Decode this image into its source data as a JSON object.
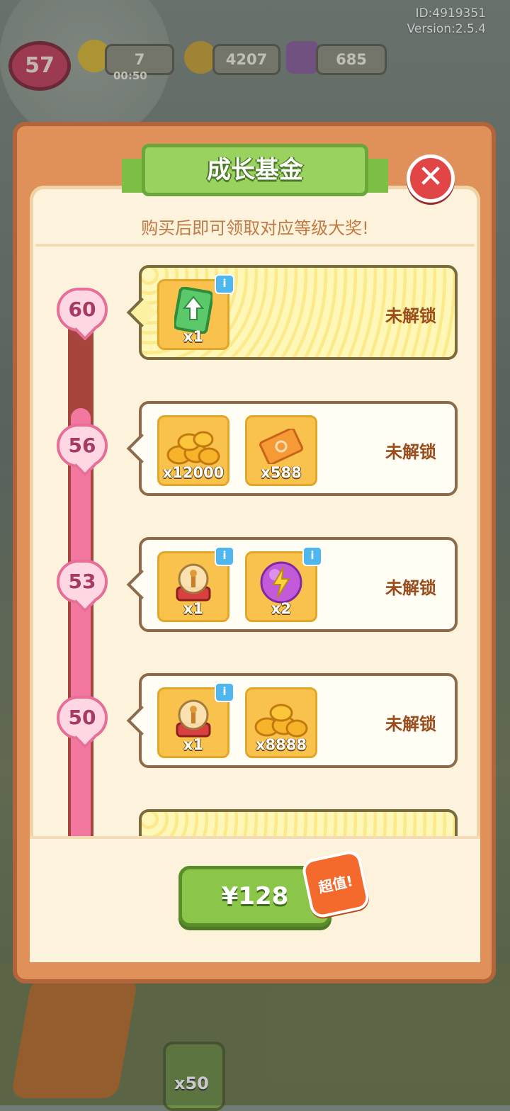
{
  "hud": {
    "id_text": "ID:4919351",
    "version_text": "Version:2.5.4",
    "level": "57",
    "energy": "7",
    "energy_timer": "00:50",
    "coins": "4207",
    "gems": "685",
    "bottom_item_qty": "x50"
  },
  "dialog": {
    "title": "成长基金",
    "subtitle": "购买后即可领取对应等级大奖!",
    "close_icon": "close-icon",
    "price": "¥128",
    "badge": "超值!",
    "tiers": [
      {
        "level": "60",
        "status": "未解锁",
        "rewards": [
          {
            "icon": "upgrade-card-icon",
            "qty": "x1",
            "info": "i"
          }
        ]
      },
      {
        "level": "56",
        "status": "未解锁",
        "rewards": [
          {
            "icon": "gold-coins-icon",
            "qty": "x12000"
          },
          {
            "icon": "ticket-icon",
            "qty": "x588"
          }
        ]
      },
      {
        "level": "53",
        "status": "未解锁",
        "rewards": [
          {
            "icon": "crystal-machine-icon",
            "qty": "x1",
            "info": "i"
          },
          {
            "icon": "energy-orb-icon",
            "qty": "x2",
            "info": "i"
          }
        ]
      },
      {
        "level": "50",
        "status": "未解锁",
        "rewards": [
          {
            "icon": "crystal-machine-icon",
            "qty": "x1",
            "info": "i"
          },
          {
            "icon": "gold-coins-icon",
            "qty": "x8888"
          }
        ]
      }
    ]
  },
  "colors": {
    "panel": "#e0915a",
    "title_green": "#99d25f",
    "track_pink": "#f3789f",
    "button_green": "#8bc64a",
    "status_brown": "#9a4c1d"
  }
}
